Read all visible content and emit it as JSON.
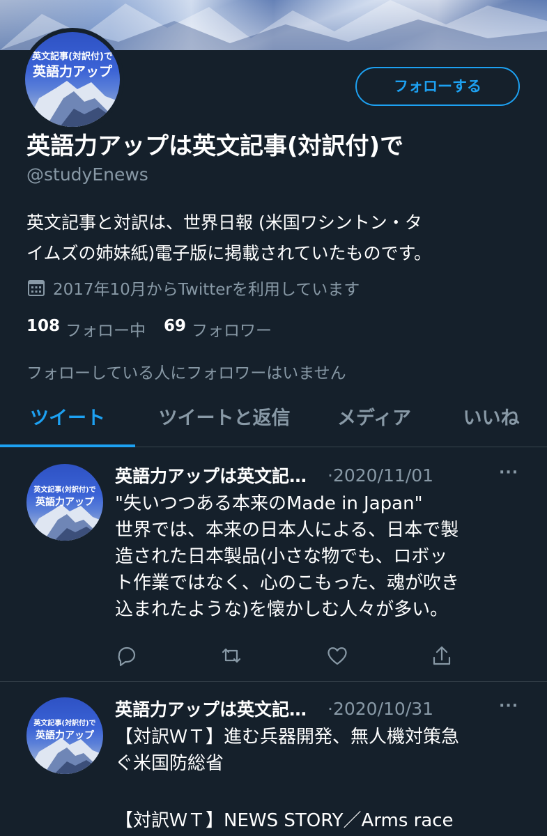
{
  "profile": {
    "avatar_text_line1": "英文記事(対訳付)で",
    "avatar_text_line2": "英語力アップ",
    "follow_label": "フォローする",
    "display_name": "英語力アップは英文記事(対訳付)で",
    "handle": "@studyEnews",
    "bio_line1": "英文記事と対訳は、世界日報 (米国ワシントン・タ",
    "bio_line2": "イムズの姉妹紙)電子版に掲載されていたものです。",
    "joined": "2017年10月からTwitterを利用しています",
    "following_count": "108",
    "following_label": "フォロー中",
    "followers_count": "69",
    "followers_label": "フォロワー",
    "no_followers_text": "フォローしている人にフォロワーはいません"
  },
  "tabs": [
    {
      "label": "ツイート",
      "active": true
    },
    {
      "label": "ツイートと返信",
      "active": false
    },
    {
      "label": "メディア",
      "active": false
    },
    {
      "label": "いいね",
      "active": false
    }
  ],
  "tweets": [
    {
      "name": "英語力アップは英文記…",
      "date": "·2020/11/01",
      "more": "···",
      "lines": [
        "\"失いつつある本来のMade in Japan\"",
        "世界では、本来の日本人による、日本で製",
        "造された日本製品(小さな物でも、ロボッ",
        "ト作業ではなく、心のこもった、魂が吹き",
        "込まれたような)を懐かしむ人々が多い。"
      ],
      "actions": [
        "reply-icon",
        "retweet-icon",
        "like-icon",
        "share-icon"
      ]
    },
    {
      "name": "英語力アップは英文記…",
      "date": "·2020/10/31",
      "more": "···",
      "lines": [
        "【対訳ＷＴ】進む兵器開発、無人機対策急",
        "ぐ米国防総省",
        "",
        "【対訳ＷＴ】NEWS STORY／Arms race"
      ]
    }
  ],
  "colors": {
    "background": "#15202b",
    "accent": "#1da1f2",
    "secondary_text": "#8899a6",
    "divider": "#38444d"
  }
}
